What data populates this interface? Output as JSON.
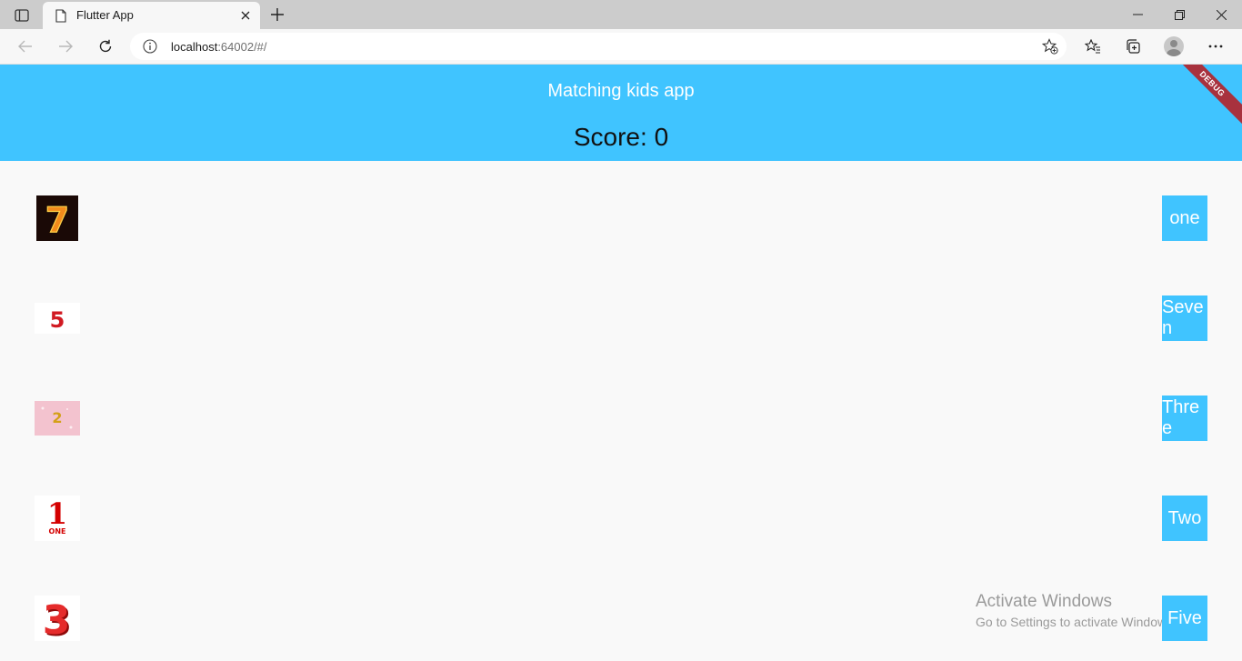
{
  "browser": {
    "tab_title": "Flutter App",
    "url_host": "localhost",
    "url_rest": ":64002/#/"
  },
  "app": {
    "title": "Matching kids app",
    "score_label": "Score: 0",
    "debug_banner": "DEBUG",
    "accent_color": "#40c4ff"
  },
  "number_images": [
    {
      "digit": "7",
      "caption": ""
    },
    {
      "digit": "5",
      "caption": ""
    },
    {
      "digit": "2",
      "caption": ""
    },
    {
      "digit": "1",
      "caption": "ONE"
    },
    {
      "digit": "3",
      "caption": ""
    }
  ],
  "word_tiles": [
    "one",
    "Seven",
    "Three",
    "Two",
    "Five"
  ],
  "watermark": {
    "title": "Activate Windows",
    "subtitle": "Go to Settings to activate Windows."
  }
}
